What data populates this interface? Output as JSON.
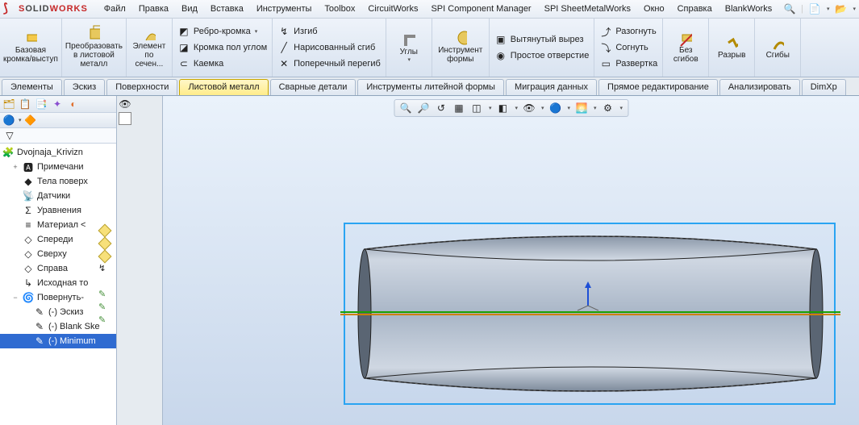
{
  "app": {
    "name": "SOLIDWORKS"
  },
  "menu": {
    "items": [
      "Файл",
      "Правка",
      "Вид",
      "Вставка",
      "Инструменты",
      "Toolbox",
      "CircuitWorks",
      "SPI Component Manager",
      "SPI SheetMetalWorks",
      "Окно",
      "Справка",
      "BlankWorks"
    ]
  },
  "ribbon": {
    "groups": {
      "base": {
        "label": "Базовая\nкромка/выступ"
      },
      "convert": {
        "label": "Преобразовать\nв листовой\nметалл"
      },
      "lofted": {
        "label": "Элемент\nпо\nсечен..."
      },
      "corners": {
        "label": "Углы"
      },
      "formtool": {
        "label": "Инструмент\nформы"
      },
      "nobends": {
        "label": "Без\nсгибов"
      },
      "cut": {
        "label": "Разрыв"
      },
      "bends": {
        "label": "Сгибы"
      }
    },
    "col1": [
      {
        "icon": "edge-flange-icon",
        "label": "Ребро-кромка"
      },
      {
        "icon": "miter-flange-icon",
        "label": "Кромка пол углом"
      },
      {
        "icon": "hem-icon",
        "label": "Каемка"
      }
    ],
    "col2": [
      {
        "icon": "jog-icon",
        "label": "Изгиб"
      },
      {
        "icon": "sketched-bend-icon",
        "label": "Нарисованный сгиб"
      },
      {
        "icon": "cross-break-icon",
        "label": "Поперечный перегиб"
      }
    ],
    "col3": [
      {
        "icon": "extruded-cut-icon",
        "label": "Вытянутый вырез"
      },
      {
        "icon": "simple-hole-icon",
        "label": "Простое отверстие"
      }
    ],
    "col4": [
      {
        "icon": "unfold-icon",
        "label": "Разогнуть"
      },
      {
        "icon": "fold-icon",
        "label": "Согнуть"
      },
      {
        "icon": "flatten-icon",
        "label": "Развертка"
      }
    ]
  },
  "tabs": {
    "items": [
      "Элементы",
      "Эскиз",
      "Поверхности",
      "Листовой металл",
      "Сварные детали",
      "Инструменты литейной формы",
      "Миграция данных",
      "Прямое редактирование",
      "Анализировать",
      "DimXp"
    ],
    "active_index": 3
  },
  "feature_tree": {
    "root": "Dvojnaja_Krivizn",
    "nodes": [
      {
        "icon": "annotations-icon",
        "label": "Примечани",
        "indent": 1,
        "tw": "+"
      },
      {
        "icon": "surface-bodies-icon",
        "label": "Тела поверх",
        "indent": 1
      },
      {
        "icon": "sensors-icon",
        "label": "Датчики",
        "indent": 1
      },
      {
        "icon": "equations-icon",
        "label": "Уравнения",
        "indent": 1
      },
      {
        "icon": "material-icon",
        "label": "Материал <",
        "indent": 1
      },
      {
        "icon": "plane-icon",
        "label": "Спереди",
        "indent": 1,
        "side": "diamond"
      },
      {
        "icon": "plane-icon",
        "label": "Сверху",
        "indent": 1,
        "side": "diamond"
      },
      {
        "icon": "plane-icon",
        "label": "Справа",
        "indent": 1,
        "side": "diamond"
      },
      {
        "icon": "origin-icon",
        "label": "Исходная то",
        "indent": 1,
        "side": "origin"
      },
      {
        "icon": "revolve-icon",
        "label": "Повернуть-",
        "indent": 1,
        "tw": "−"
      },
      {
        "icon": "sketch-icon",
        "label": "(-) Эскиз",
        "indent": 2,
        "side": "pencil"
      },
      {
        "icon": "sketch3d-icon",
        "label": "(-) Blank Ske",
        "indent": 2,
        "side": "pencil"
      },
      {
        "icon": "sketch3d-icon",
        "label": "(-) Minimum",
        "indent": 2,
        "side": "pencil",
        "sel": true
      }
    ]
  },
  "icons": {
    "search": "🔍",
    "new": "📄",
    "open": "📂",
    "star": "★",
    "help": "?",
    "funnel": "▽"
  }
}
